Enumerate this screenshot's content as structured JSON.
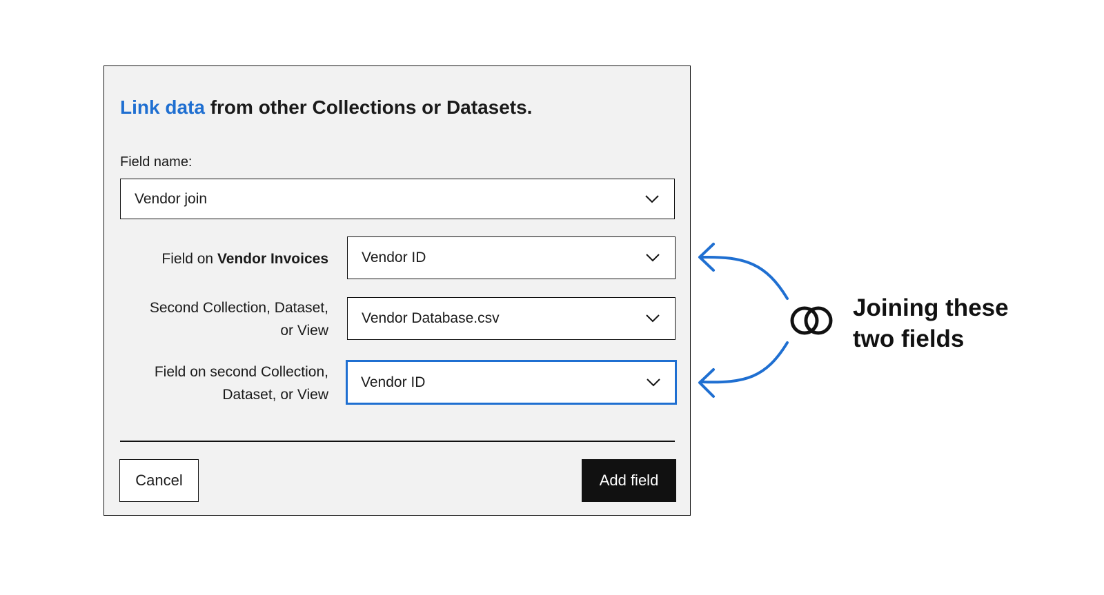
{
  "dialog": {
    "title_accent": "Link data",
    "title_rest": " from other Collections or Datasets.",
    "field_name_label": "Field name:",
    "field_name_value": "Vendor join",
    "rows": [
      {
        "label_prefix": "Field on ",
        "label_bold": "Vendor Invoices",
        "value": "Vendor ID"
      },
      {
        "label_line1": "Second Collection, Dataset,",
        "label_line2": "or View",
        "value": "Vendor Database.csv"
      },
      {
        "label_line1": "Field on second Collection,",
        "label_line2": "Dataset, or View",
        "value": "Vendor ID"
      }
    ],
    "cancel_label": "Cancel",
    "add_label": "Add field"
  },
  "annotation": {
    "line1": "Joining these",
    "line2": "two fields",
    "icon": "link-rings-icon",
    "arrow_color": "#1f6fd1"
  },
  "colors": {
    "accent": "#1f6fd1",
    "dialog_bg": "#f2f2f2",
    "primary_button": "#111111"
  }
}
